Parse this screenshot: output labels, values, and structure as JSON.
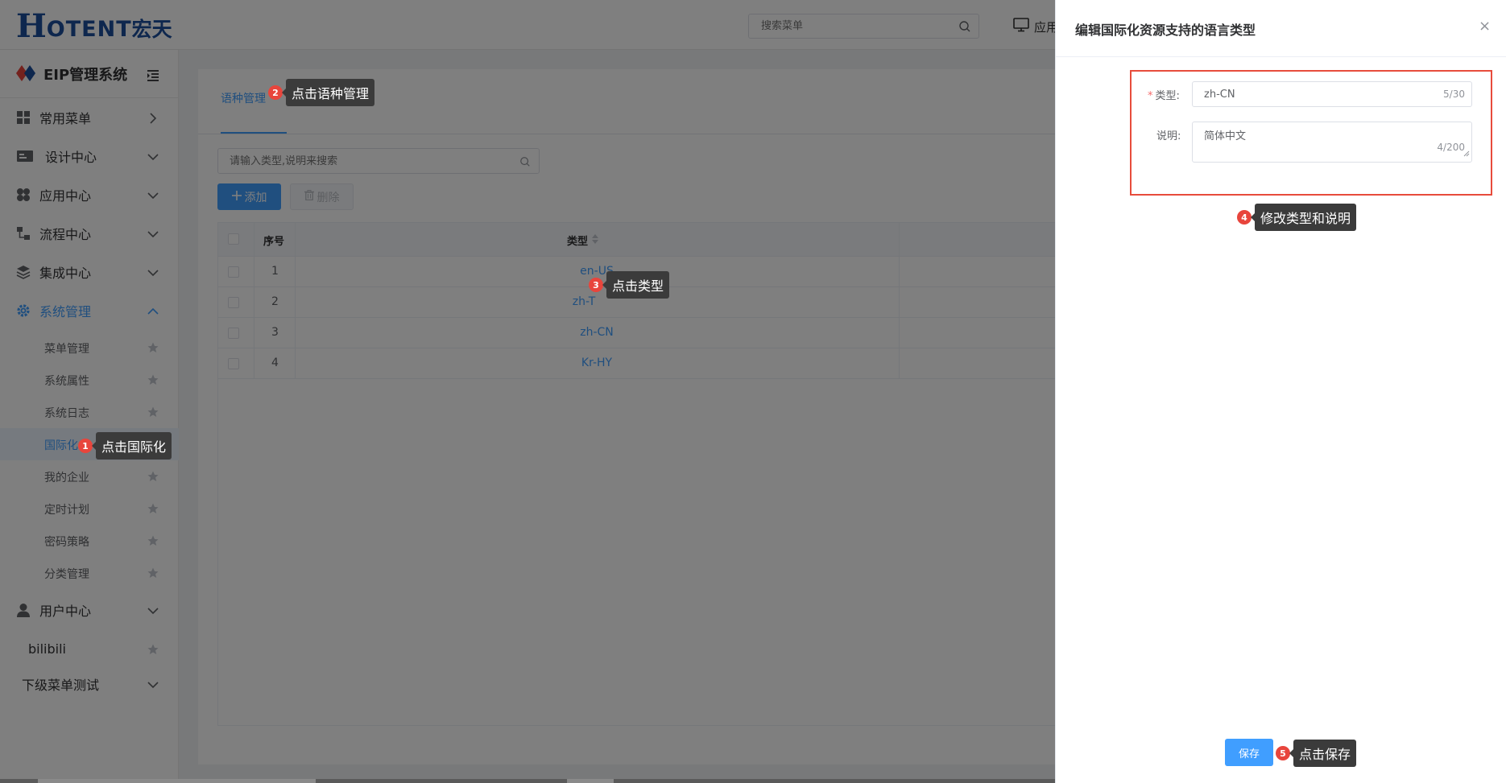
{
  "brand": {
    "logo_h": "H",
    "logo_rest": "OTENT",
    "logo_cn": "宏天"
  },
  "topbar": {
    "search_placeholder": "搜索菜单",
    "app_label": "应用"
  },
  "sidebar": {
    "system_title": "EIP管理系统",
    "menus": [
      {
        "label": "常用菜单",
        "icon": "grid-icon"
      },
      {
        "label": "设计中心",
        "icon": "card-icon"
      },
      {
        "label": "应用中心",
        "icon": "clover-icon"
      },
      {
        "label": "流程中心",
        "icon": "flow-icon"
      },
      {
        "label": "集成中心",
        "icon": "layers-icon"
      },
      {
        "label": "系统管理",
        "icon": "gear-icon"
      }
    ],
    "sub_items": [
      "菜单管理",
      "系统属性",
      "系统日志",
      "国际化",
      "我的企业",
      "定时计划",
      "密码策略",
      "分类管理"
    ],
    "more_menus": [
      {
        "label": "用户中心",
        "icon": "user-icon"
      },
      {
        "label": "bilibili"
      },
      {
        "label": "下级菜单测试"
      }
    ]
  },
  "main": {
    "tab_label": "语种管理",
    "search_placeholder": "请输入类型,说明来搜索",
    "add_label": "添加",
    "delete_label": "删除",
    "table": {
      "col_seq": "序号",
      "col_type": "类型",
      "rows": [
        {
          "seq": "1",
          "type": "en-US"
        },
        {
          "seq": "2",
          "type": "zh-T"
        },
        {
          "seq": "3",
          "type": "zh-CN"
        },
        {
          "seq": "4",
          "type": "Kr-HY"
        }
      ]
    }
  },
  "drawer": {
    "title": "编辑国际化资源支持的语言类型",
    "close_icon": "×",
    "type_label": "类型:",
    "type_required_mark": "*",
    "type_value": "zh-CN",
    "type_count": "5/30",
    "desc_label": "说明:",
    "desc_value": "简体中文",
    "desc_count": "4/200",
    "save_label": "保存"
  },
  "steps": [
    {
      "num": "1",
      "text": "点击国际化"
    },
    {
      "num": "2",
      "text": "点击语种管理"
    },
    {
      "num": "3",
      "text": "点击类型"
    },
    {
      "num": "4",
      "text": "修改类型和说明"
    },
    {
      "num": "5",
      "text": "点击保存"
    }
  ],
  "colors": {
    "primary": "#409eff",
    "brand": "#1c4f9c",
    "step_badge": "#e8453c",
    "highlight": "#e74c3c"
  }
}
